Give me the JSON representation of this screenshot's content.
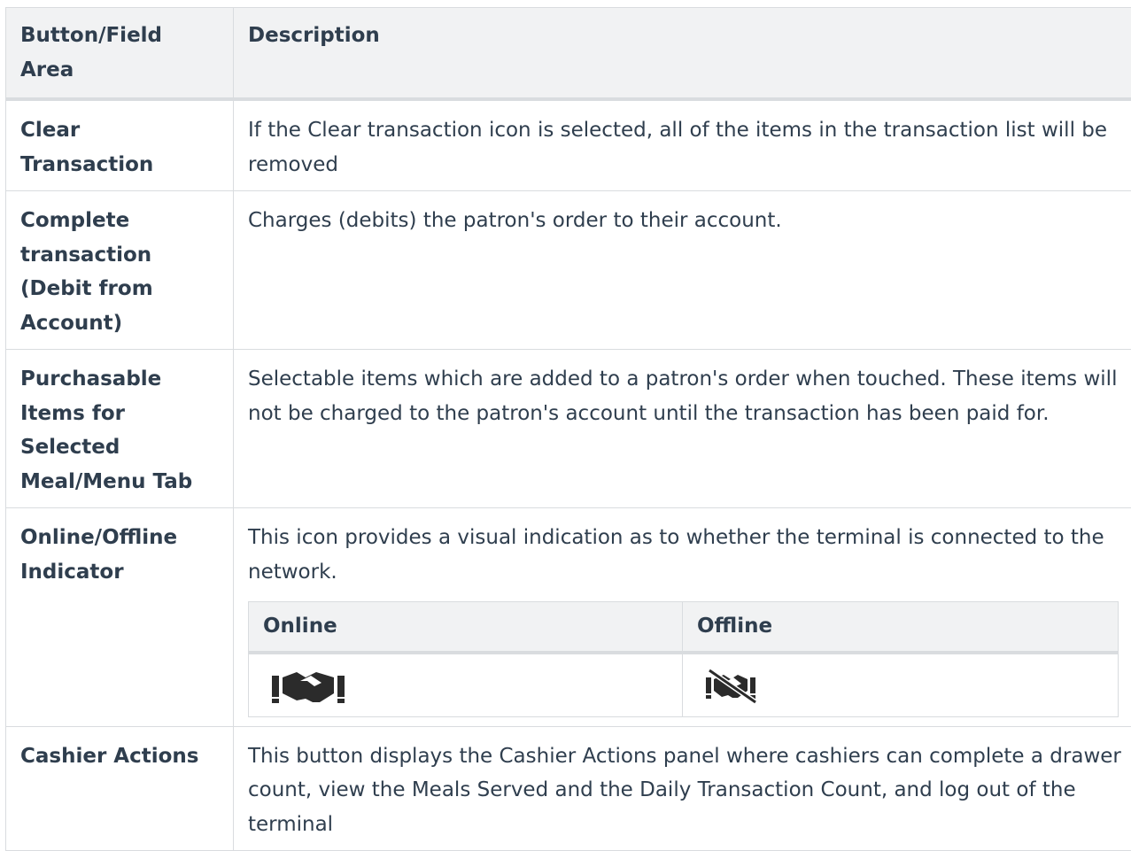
{
  "table": {
    "headers": [
      "Button/Field Area",
      "Description"
    ],
    "rows": [
      {
        "label": "Clear Transaction",
        "description": "If the Clear transaction icon is selected, all of the items in the transaction list will be removed"
      },
      {
        "label": "Complete transaction (Debit from Account)",
        "description": "Charges (debits) the patron's order to their account."
      },
      {
        "label": "Purchasable Items for Selected Meal/Menu Tab",
        "description": "Selectable items which are added to a patron's order when touched. These items will not be charged to the patron's account until the transaction has been paid for."
      },
      {
        "label": "Online/Offline Indicator",
        "description": "This icon provides a visual indication as to whether the terminal is connected to the network.",
        "subtable": {
          "headers": [
            "Online",
            "Offline"
          ],
          "icons": [
            "handshake-online-icon",
            "handshake-offline-icon"
          ]
        }
      },
      {
        "label": "Cashier Actions",
        "description": "This button displays the Cashier Actions panel where cashiers can complete a drawer count, view the Meals Served and the Daily Transaction Count, and log out of the terminal"
      }
    ]
  },
  "colors": {
    "text": "#2f3e4e",
    "header_bg": "#f1f2f3",
    "border": "#d9dcdf",
    "icon": "#2b2b2b"
  }
}
